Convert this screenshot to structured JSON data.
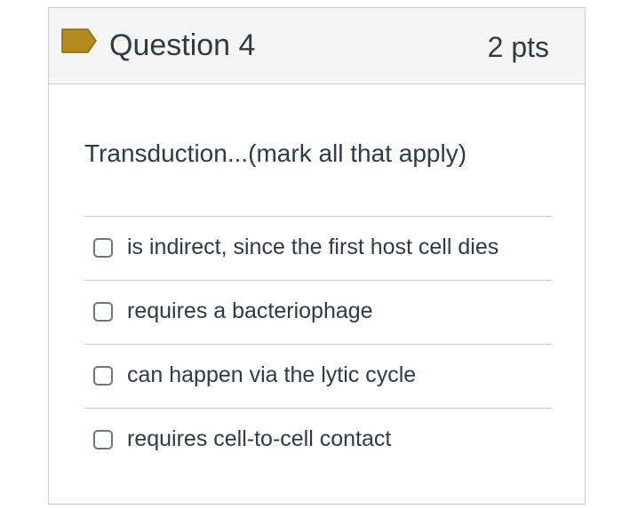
{
  "question": {
    "title": "Question 4",
    "points": "2 pts",
    "flag_icon": "flag-icon",
    "flag_color": "#b58a1d",
    "text": "Transduction...(mark all that apply)"
  },
  "answers": [
    {
      "label": "is indirect, since the first host cell dies",
      "checked": false
    },
    {
      "label": "requires a bacteriophage",
      "checked": false
    },
    {
      "label": "can happen via the lytic cycle",
      "checked": false
    },
    {
      "label": "requires cell-to-cell contact",
      "checked": false
    }
  ]
}
